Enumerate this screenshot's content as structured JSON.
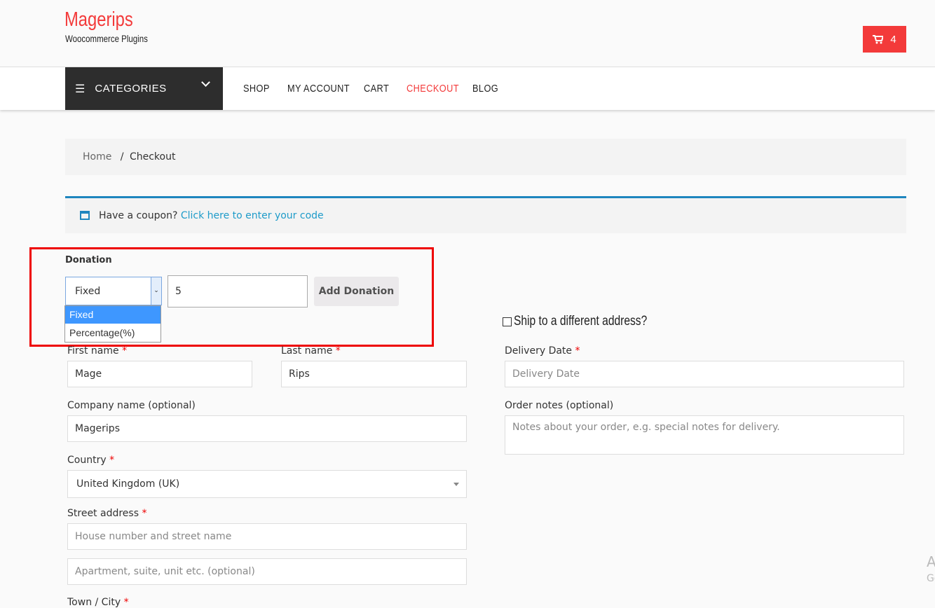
{
  "header": {
    "logo_title": "Magerips",
    "logo_subtitle": "Woocommerce Plugins",
    "cart_count": "4"
  },
  "nav": {
    "categories": "CATEGORIES",
    "links": [
      "SHOP",
      "MY ACCOUNT",
      "CART",
      "CHECKOUT",
      "BLOG"
    ],
    "active": "CHECKOUT"
  },
  "breadcrumb": {
    "home": "Home",
    "sep": "/",
    "current": "Checkout"
  },
  "coupon": {
    "text": "Have a coupon?",
    "link": "Click here to enter your code"
  },
  "donation": {
    "label": "Donation",
    "type_selected": "Fixed",
    "options": [
      "Fixed",
      "Percentage(%)"
    ],
    "amount": "5",
    "button": "Add Donation"
  },
  "billing": {
    "first_name": {
      "label": "First name",
      "value": "Mage"
    },
    "last_name": {
      "label": "Last name",
      "value": "Rips"
    },
    "company": {
      "label": "Company name (optional)",
      "value": "Magerips"
    },
    "country": {
      "label": "Country",
      "value": "United Kingdom (UK)"
    },
    "street": {
      "label": "Street address",
      "placeholder1": "House number and street name",
      "placeholder2": "Apartment, suite, unit etc. (optional)"
    },
    "town": {
      "label": "Town / City"
    }
  },
  "shipping": {
    "ship_different": "Ship to a different address?",
    "delivery_date": {
      "label": "Delivery Date",
      "placeholder": "Delivery Date"
    },
    "order_notes": {
      "label": "Order notes (optional)",
      "placeholder": "Notes about your order, e.g. special notes for delivery."
    }
  },
  "required_mark": "*",
  "watermark": {
    "line1": "A",
    "line2": "Go"
  },
  "colors": {
    "brand": "#f33a3a",
    "link": "#1e9bc9",
    "dark": "#2d2d2d"
  }
}
